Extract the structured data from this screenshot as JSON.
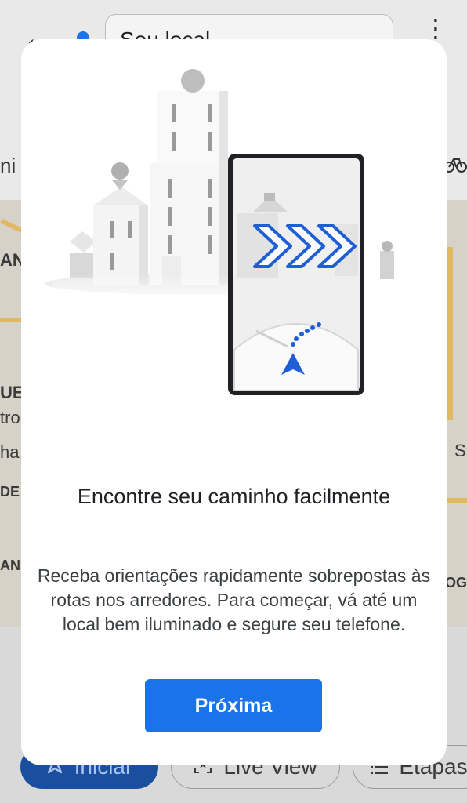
{
  "background": {
    "search_value": "Seu local",
    "back_icon_glyph": "←",
    "menu_icon_glyph": "⋮",
    "mode_left_fragment": "ni",
    "mode_right_icon": "bike-icon",
    "map_labels": [
      "ANT",
      "UE",
      "tro",
      "ha",
      "DE",
      "AN",
      "S",
      "OG"
    ],
    "bottom_chips": [
      {
        "label": "Iniciar",
        "icon": "navigation-arrow-icon"
      },
      {
        "label": "Live View",
        "icon": "live-view-icon"
      },
      {
        "label": "Etapas",
        "icon": "list-icon"
      }
    ]
  },
  "dialog": {
    "title": "Encontre seu caminho facilmente",
    "body": "Receba orientações rapidamente sobrepostas às rotas nos arredores. Para começar, vá até um local bem iluminado e segure seu telefone.",
    "primary_button": "Próxima"
  },
  "colors": {
    "accent": "#1a73e8",
    "scrim": "#8d8d8d",
    "dialog_bg": "#ffffff"
  }
}
